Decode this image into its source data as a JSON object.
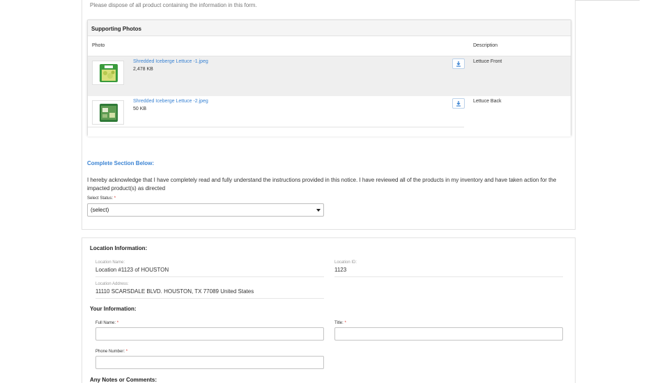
{
  "intro_text": "Please dispose of all product containing the information in this form.",
  "supporting_photos": {
    "title": "Supporting Photos",
    "col_photo": "Photo",
    "col_description": "Description",
    "rows": [
      {
        "file_name": "Shredded Iceberge Lettuce -1.jpeg",
        "file_size": "2,478 KB",
        "description": "Lettuce Front",
        "icon": "download-icon"
      },
      {
        "file_name": "Shredded Iceberge Lettuce -2.jpeg",
        "file_size": "50 KB",
        "description": "Lettuce Back",
        "icon": "download-icon"
      }
    ]
  },
  "complete_section": {
    "title": "Complete Section Below:",
    "acknowledgement": "I hereby acknowledge that I have completely read and fully understand the instructions provided in this notice. I have reviewed all of the products in my inventory and have taken action for the impacted product(s) as directed",
    "status_label": "Select Status:",
    "required_mark": "*",
    "status_value": "(select)"
  },
  "location": {
    "title": "Location Information:",
    "name_label": "Location Name:",
    "name_value": "Location #1123 of HOUSTON",
    "id_label": "Location ID:",
    "id_value": "1123",
    "address_label": "Location Address:",
    "address_value": "11110 SCARSDALE BLVD. HOUSTON, TX 77089 United States"
  },
  "your_info": {
    "title": "Your Information:",
    "full_name_label": "Full Name:",
    "title_label": "Title:",
    "phone_label": "Phone Number:",
    "required_mark": "*"
  },
  "notes_title": "Any Notes or Comments:",
  "colors": {
    "link": "#3a83d3",
    "required": "#d9342b",
    "row_highlight": "#efefef"
  }
}
